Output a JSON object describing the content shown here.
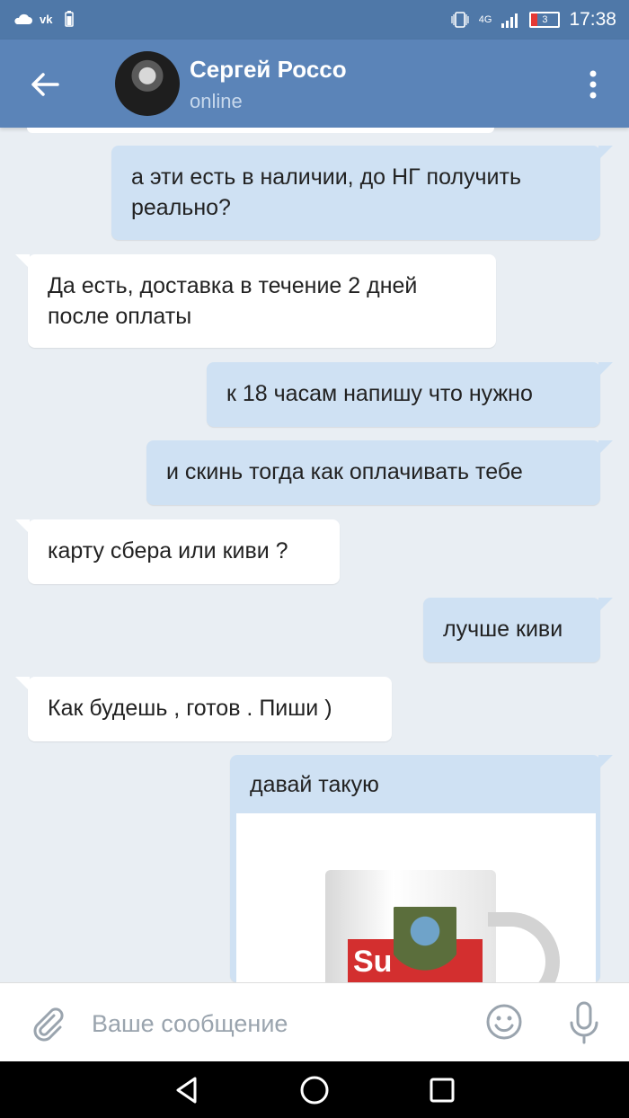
{
  "status_bar": {
    "left_icons": [
      "cloud-icon",
      "vk-icon",
      "battery-saver-icon"
    ],
    "network": "4G",
    "battery_level": "3",
    "time": "17:38"
  },
  "header": {
    "contact_name": "Сергей Россо",
    "contact_status": "online"
  },
  "messages": [
    {
      "direction": "out",
      "text": "а эти есть в наличии, до НГ получить реально?"
    },
    {
      "direction": "in",
      "text": "Да есть, доставка в течение 2 дней после оплаты"
    },
    {
      "direction": "out",
      "text": "к 18 часам напишу что нужно"
    },
    {
      "direction": "out",
      "text": "и скинь тогда как оплачивать тебе"
    },
    {
      "direction": "in",
      "text": "карту сбера или киви ?"
    },
    {
      "direction": "out",
      "text": "лучше киви"
    },
    {
      "direction": "in",
      "text": "Как будешь , готов . Пиши )"
    },
    {
      "direction": "out",
      "text": "давай такую",
      "attachment": "photo",
      "attachment_logo_text": "Su"
    }
  ],
  "input": {
    "placeholder": "Ваше сообщение"
  },
  "colors": {
    "header": "#5b84b8",
    "status_bar": "#4f78a8",
    "outgoing_bubble": "#cfe1f3",
    "incoming_bubble": "#ffffff",
    "chat_background": "#e9eef3"
  }
}
